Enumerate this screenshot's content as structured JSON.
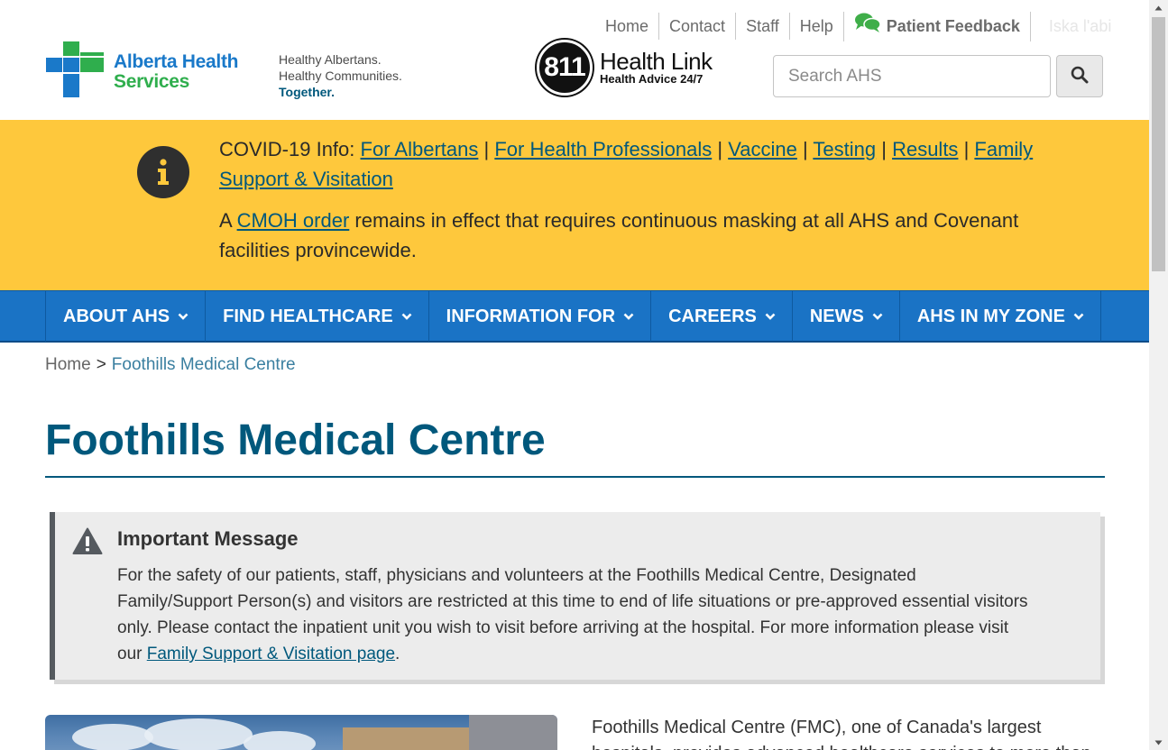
{
  "utility_nav": {
    "home": "Home",
    "contact": "Contact",
    "staff": "Staff",
    "help": "Help",
    "feedback": "Patient Feedback",
    "language": "Iska l'abi"
  },
  "logo": {
    "line1": "Alberta Health",
    "line2": "Services"
  },
  "tagline": {
    "line1": "Healthy Albertans.",
    "line2": "Healthy Communities.",
    "line3": "Together."
  },
  "healthlink": {
    "number": "811",
    "title": "Health Link",
    "subtitle": "Health Advice 24/7"
  },
  "search": {
    "placeholder": "Search AHS"
  },
  "covid_banner": {
    "prefix": "COVID-19 Info:",
    "links": [
      "For Albertans",
      "For Health Professionals",
      "Vaccine",
      "Testing",
      "Results",
      "Family Support & Visitation"
    ],
    "separator": "|",
    "line2_prefix": "A",
    "line2_link": "CMOH order",
    "line2_suffix": "remains in effect that requires continuous masking at all AHS and Covenant facilities provincewide."
  },
  "main_nav": [
    "ABOUT AHS",
    "FIND HEALTHCARE",
    "INFORMATION FOR",
    "CAREERS",
    "NEWS",
    "AHS IN MY ZONE"
  ],
  "breadcrumb": {
    "home": "Home",
    "separator": ">",
    "current": "Foothills Medical Centre"
  },
  "page_title": "Foothills Medical Centre",
  "important_message": {
    "heading": "Important Message",
    "body": "For the safety of our patients, staff, physicians and volunteers at the Foothills Medical Centre, Designated Family/Support Person(s) and visitors are restricted at this time to end of life situations or pre-approved essential visitors only. Please contact the inpatient unit you wish to visit before arriving at the hospital. For more information please visit our",
    "link": "Family Support & Visitation page",
    "end": "."
  },
  "intro_text": "Foothills Medical Centre (FMC), one of Canada's largest hospitals, provides advanced healthcare services to more than",
  "colors": {
    "brand_blue": "#1a73c5",
    "banner_yellow": "#fec83c",
    "title_teal": "#00587c",
    "logo_green": "#2fae4d"
  }
}
